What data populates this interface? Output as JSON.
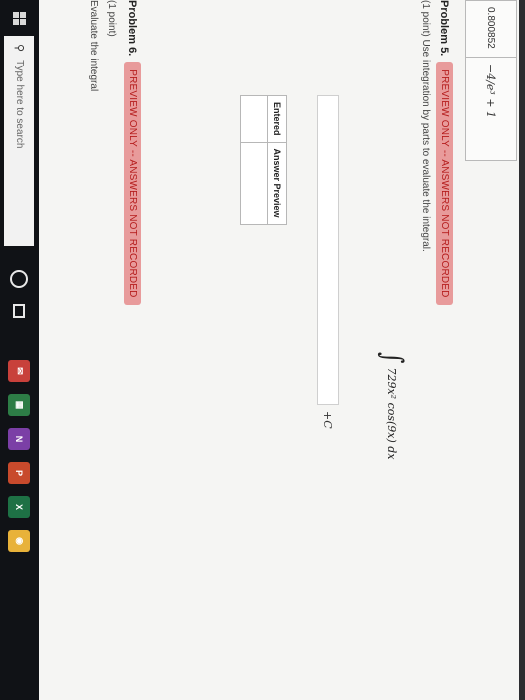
{
  "previous_answer": {
    "value": "0.800852",
    "expression": "−4/e³ + 1"
  },
  "problem5": {
    "title": "Problem 5.",
    "badge": "PREVIEW ONLY -- ANSWERS NOT RECORDED",
    "instructions": "(1 point) Use integration by parts to evaluate the integral.",
    "integral_sign": "∫",
    "integrand": "729x² cos(9x) dx",
    "answer_value": "",
    "constant": "+C",
    "entered_table": {
      "headers": [
        "Entered",
        "Answer Preview"
      ],
      "rows": [
        [
          "",
          ""
        ]
      ]
    }
  },
  "problem6": {
    "title": "Problem 6.",
    "badge": "PREVIEW ONLY -- ANSWERS NOT RECORDED",
    "points": "(1 point)",
    "instructions": "Evaluate the integral"
  },
  "taskbar": {
    "search_placeholder": "Type here to search",
    "search_icon": "search-icon",
    "apps": [
      {
        "icon": "mail-icon",
        "color": "#c8413b",
        "glyph": "✉"
      },
      {
        "icon": "store-icon",
        "color": "#2d7d46",
        "glyph": "▦"
      },
      {
        "icon": "onenote-icon",
        "color": "#7b3fa6",
        "glyph": "N"
      },
      {
        "icon": "powerpoint-icon",
        "color": "#c84a2c",
        "glyph": "P"
      },
      {
        "icon": "excel-icon",
        "color": "#1e7145",
        "glyph": "X"
      },
      {
        "icon": "chrome-icon",
        "color": "#e8b23a",
        "glyph": "◉"
      }
    ]
  }
}
